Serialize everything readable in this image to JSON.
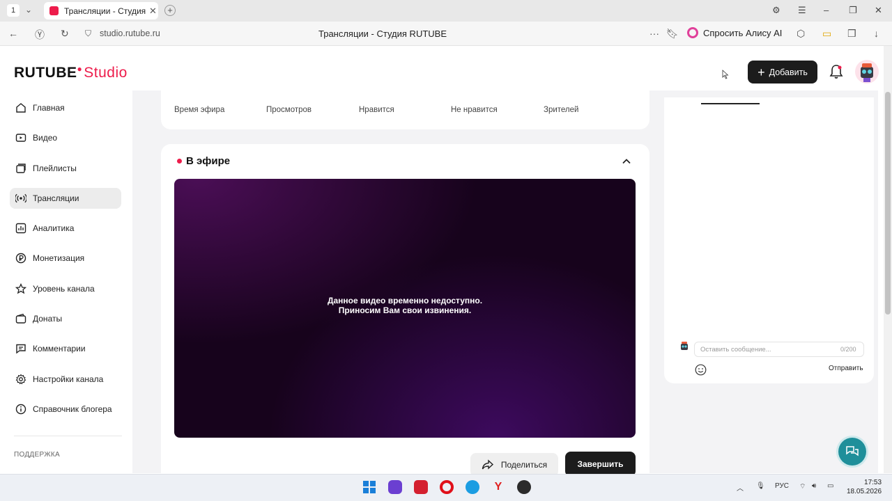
{
  "browser": {
    "tab_number": "1",
    "tab_title": "Трансляции - Студия RUTUBE",
    "url": "studio.rutube.ru",
    "page_title": "Трансляции - Студия RUTUBE",
    "alice_label": "Спросить Алису AI"
  },
  "header": {
    "logo_main": "RUTUBE",
    "logo_studio": "Studio",
    "add_button": "Добавить"
  },
  "sidebar": {
    "items": [
      {
        "label": "Главная",
        "icon": "home-icon"
      },
      {
        "label": "Видео",
        "icon": "video-icon"
      },
      {
        "label": "Плейлисты",
        "icon": "playlist-icon"
      },
      {
        "label": "Трансляции",
        "icon": "broadcast-icon",
        "active": true
      },
      {
        "label": "Аналитика",
        "icon": "analytics-icon"
      },
      {
        "label": "Монетизация",
        "icon": "ruble-icon"
      },
      {
        "label": "Уровень канала",
        "icon": "star-icon"
      },
      {
        "label": "Донаты",
        "icon": "wallet-icon"
      },
      {
        "label": "Комментарии",
        "icon": "comment-icon"
      },
      {
        "label": "Настройки канала",
        "icon": "gear-icon"
      },
      {
        "label": "Справочник блогера",
        "icon": "info-icon"
      }
    ],
    "support_label": "ПОДДЕРЖКА"
  },
  "stats": {
    "labels": [
      "Время эфира",
      "Просмотров",
      "Нравится",
      "Не нравится",
      "Зрителей"
    ]
  },
  "live": {
    "title": "В эфире",
    "player_message_line1": "Данное видео временно недоступно.",
    "player_message_line2": "Приносим Вам свои извинения.",
    "share_button": "Поделиться",
    "finish_button": "Завершить"
  },
  "chat": {
    "placeholder": "Оставить сообщение...",
    "counter": "0/200",
    "send_label": "Отправить"
  },
  "taskbar": {
    "language": "РУС",
    "time": "17:53",
    "date": "18.05.2026"
  },
  "colors": {
    "brand": "#ed1c4b",
    "dark_button": "#1c1c1c",
    "help_fab": "#1f8f9a"
  }
}
